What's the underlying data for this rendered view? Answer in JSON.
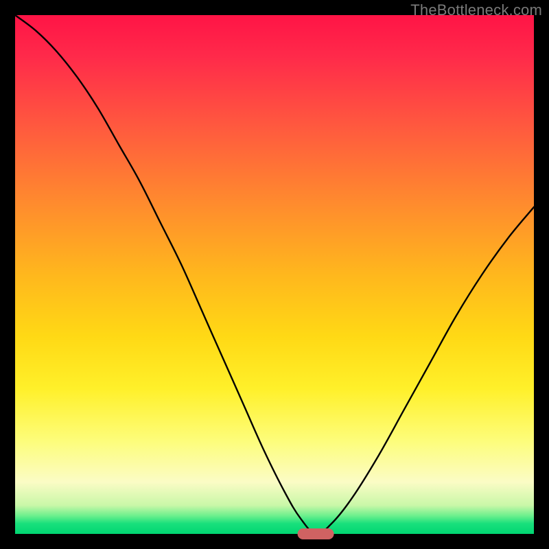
{
  "watermark": "TheBottleneck.com",
  "colors": {
    "frame": "#000000",
    "curve": "#000000",
    "marker": "#d06262",
    "gradient_top": "#ff1446",
    "gradient_bottom": "#00d672"
  },
  "chart_data": {
    "type": "line",
    "title": "",
    "xlabel": "",
    "ylabel": "",
    "xlim": [
      0,
      100
    ],
    "ylim": [
      0,
      100
    ],
    "grid": false,
    "legend": false,
    "annotations": [],
    "optimum_x": 58,
    "marker": {
      "x_center": 58,
      "y": 0,
      "width_x": 7
    },
    "series": [
      {
        "name": "bottleneck-curve",
        "x": [
          0,
          4,
          8,
          12,
          16,
          20,
          24,
          28,
          32,
          36,
          40,
          44,
          48,
          52,
          55,
          58,
          61,
          65,
          70,
          75,
          80,
          85,
          90,
          95,
          100
        ],
        "values": [
          100,
          97,
          93,
          88,
          82,
          75,
          68,
          60,
          52,
          43,
          34,
          25,
          16,
          8,
          3,
          0,
          2,
          7,
          15,
          24,
          33,
          42,
          50,
          57,
          63
        ]
      }
    ]
  }
}
